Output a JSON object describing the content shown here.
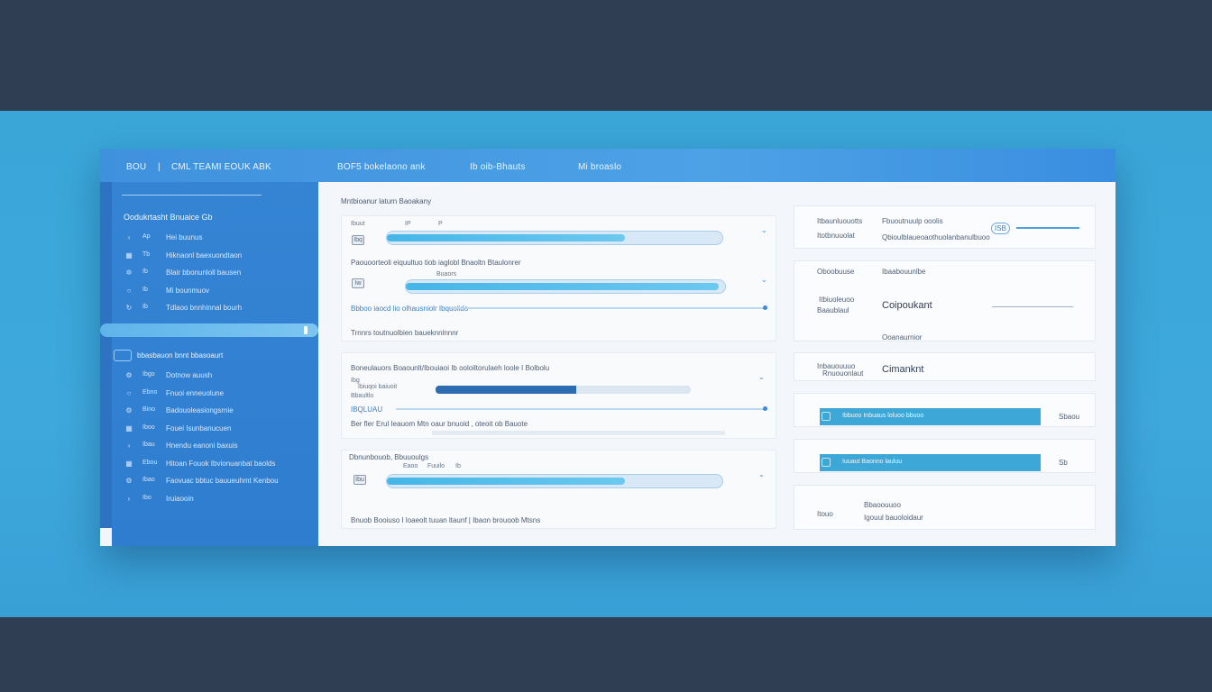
{
  "window": {
    "title": "BOU",
    "title_sep": "|",
    "app_name": "CML TEAMI EOUK ABK",
    "menu": [
      "BOF5  bokelaono ank",
      "Ib oib-Bhauts",
      "Mi broaslo"
    ]
  },
  "sidebar": {
    "section1_title": "Oodukrtasht Bnuaice Gb",
    "section1_items": [
      {
        "icon": "chevron-icon",
        "code": "Ap",
        "label": "Hei buunus"
      },
      {
        "icon": "grid-icon",
        "code": "Tb",
        "label": "Hiknaonl baexuondtaon"
      },
      {
        "icon": "gear-icon",
        "code": "Ib",
        "label": "Blair bbonunloll bausen"
      },
      {
        "icon": "circle-icon",
        "code": "Ib",
        "label": "Mi bounmuov"
      },
      {
        "icon": "refresh-icon",
        "code": "Ib",
        "label": "Tdlaoo bnnhinnal bourh"
      }
    ],
    "section2_title": "bbasbauon bnnt bbasoaurt",
    "section2_items": [
      {
        "icon": "settings-icon",
        "code": "Ibgo",
        "label": "Dotnow auush"
      },
      {
        "icon": "circle-icon",
        "code": "Ebno",
        "label": "Fnuoi enneuolune"
      },
      {
        "icon": "settings-icon",
        "code": "Bino",
        "label": "Badouoleasiongsrnie"
      },
      {
        "icon": "grid-icon",
        "code": "Iboo",
        "label": "Fouei Isunbanucuen"
      },
      {
        "icon": "chevron-icon",
        "code": "Ibau",
        "label": "Hnendu eanoni baxuis"
      },
      {
        "icon": "grid-icon",
        "code": "Ebou",
        "label": "Hitoan Fouok Ibvionuanbat baolds"
      },
      {
        "icon": "settings-icon",
        "code": "Ibao",
        "label": "Faovuac bbtuc bauueuhmt Kenbou"
      },
      {
        "icon": "chevron-icon",
        "code": "Ibo",
        "label": "Iruiaooin"
      }
    ]
  },
  "main": {
    "title": "Mntbioanur laturn Baoakany",
    "card1": {
      "labels": [
        "Ibuut",
        "IP",
        "P"
      ],
      "row1_code": "Ibq",
      "progress1": 0.71,
      "subtitle": "Paouoorteoli eiquultuo tiob iaglobl Bnaoltn Btaulonrer",
      "sub_small": "Buaors",
      "row2_code": "Iw",
      "progress2": 0.98,
      "line_label": "Bbboo iaocd lio olhausniolr Ibquolido",
      "footer": "Trnnrs toutnuolbien baueknnlnnnr"
    },
    "card2": {
      "title": "Boneulauors Boaounlt/Ibouiaoi Ib ooloiltorulaeh loole I Bolbolu",
      "code": "Ibg",
      "mini": "Ibiuqoi baiuoit",
      "small": "Bbaultlo",
      "progress": 0.55,
      "line_label": "IBQLUAU",
      "footer": "Ber fler Erul Ieauom Mtn oaur bnuoid , oteoit ob Bauote"
    },
    "card3": {
      "title": "Dbnunbouob, Bbuuoulgs",
      "labels": [
        "Eaoo",
        "Fuuilo",
        "Ib"
      ],
      "code": "Ibu",
      "progress": 0.71,
      "footer": "Bnuob Booiuso I loaeolt tuuan ltaunf | Ibaon brouoob Mtsns"
    }
  },
  "right": {
    "card1": {
      "a": "Itbaunluouotts",
      "a2": "Itotbnuuolat",
      "b": "Fbuoutnuulp ooolis",
      "b2": "Qbioulblaueoaothuolanbanulbuoo",
      "badge": "ISB"
    },
    "card2": {
      "a": "Oboobuuse",
      "a2": "Itbiuoleuoo",
      "a3": "Baaublaul",
      "b": "Ibaabouunlbe",
      "value": "Coipoukant",
      "foot": "Ooanaurnior"
    },
    "card3": {
      "a": "Inbauouuuo",
      "a2": "Rnuouonlaut",
      "value": "Cimanknt"
    },
    "card4": {
      "bar_label": "Ibbuoo Inbuaus loluoo bbuoo",
      "value": "Sbaou"
    },
    "card5": {
      "bar_label": "Iuuaut Baonno lauluu",
      "value": "Sb"
    },
    "card6": {
      "a": "Bbaoouuoo",
      "a2": "Itouo",
      "b": "Igouul bauoloidaur"
    }
  },
  "colors": {
    "accent": "#3f91dd",
    "sidebar": "#3584d4",
    "progress": "#45b6e8",
    "bar_dark": "#2d6cb0"
  }
}
